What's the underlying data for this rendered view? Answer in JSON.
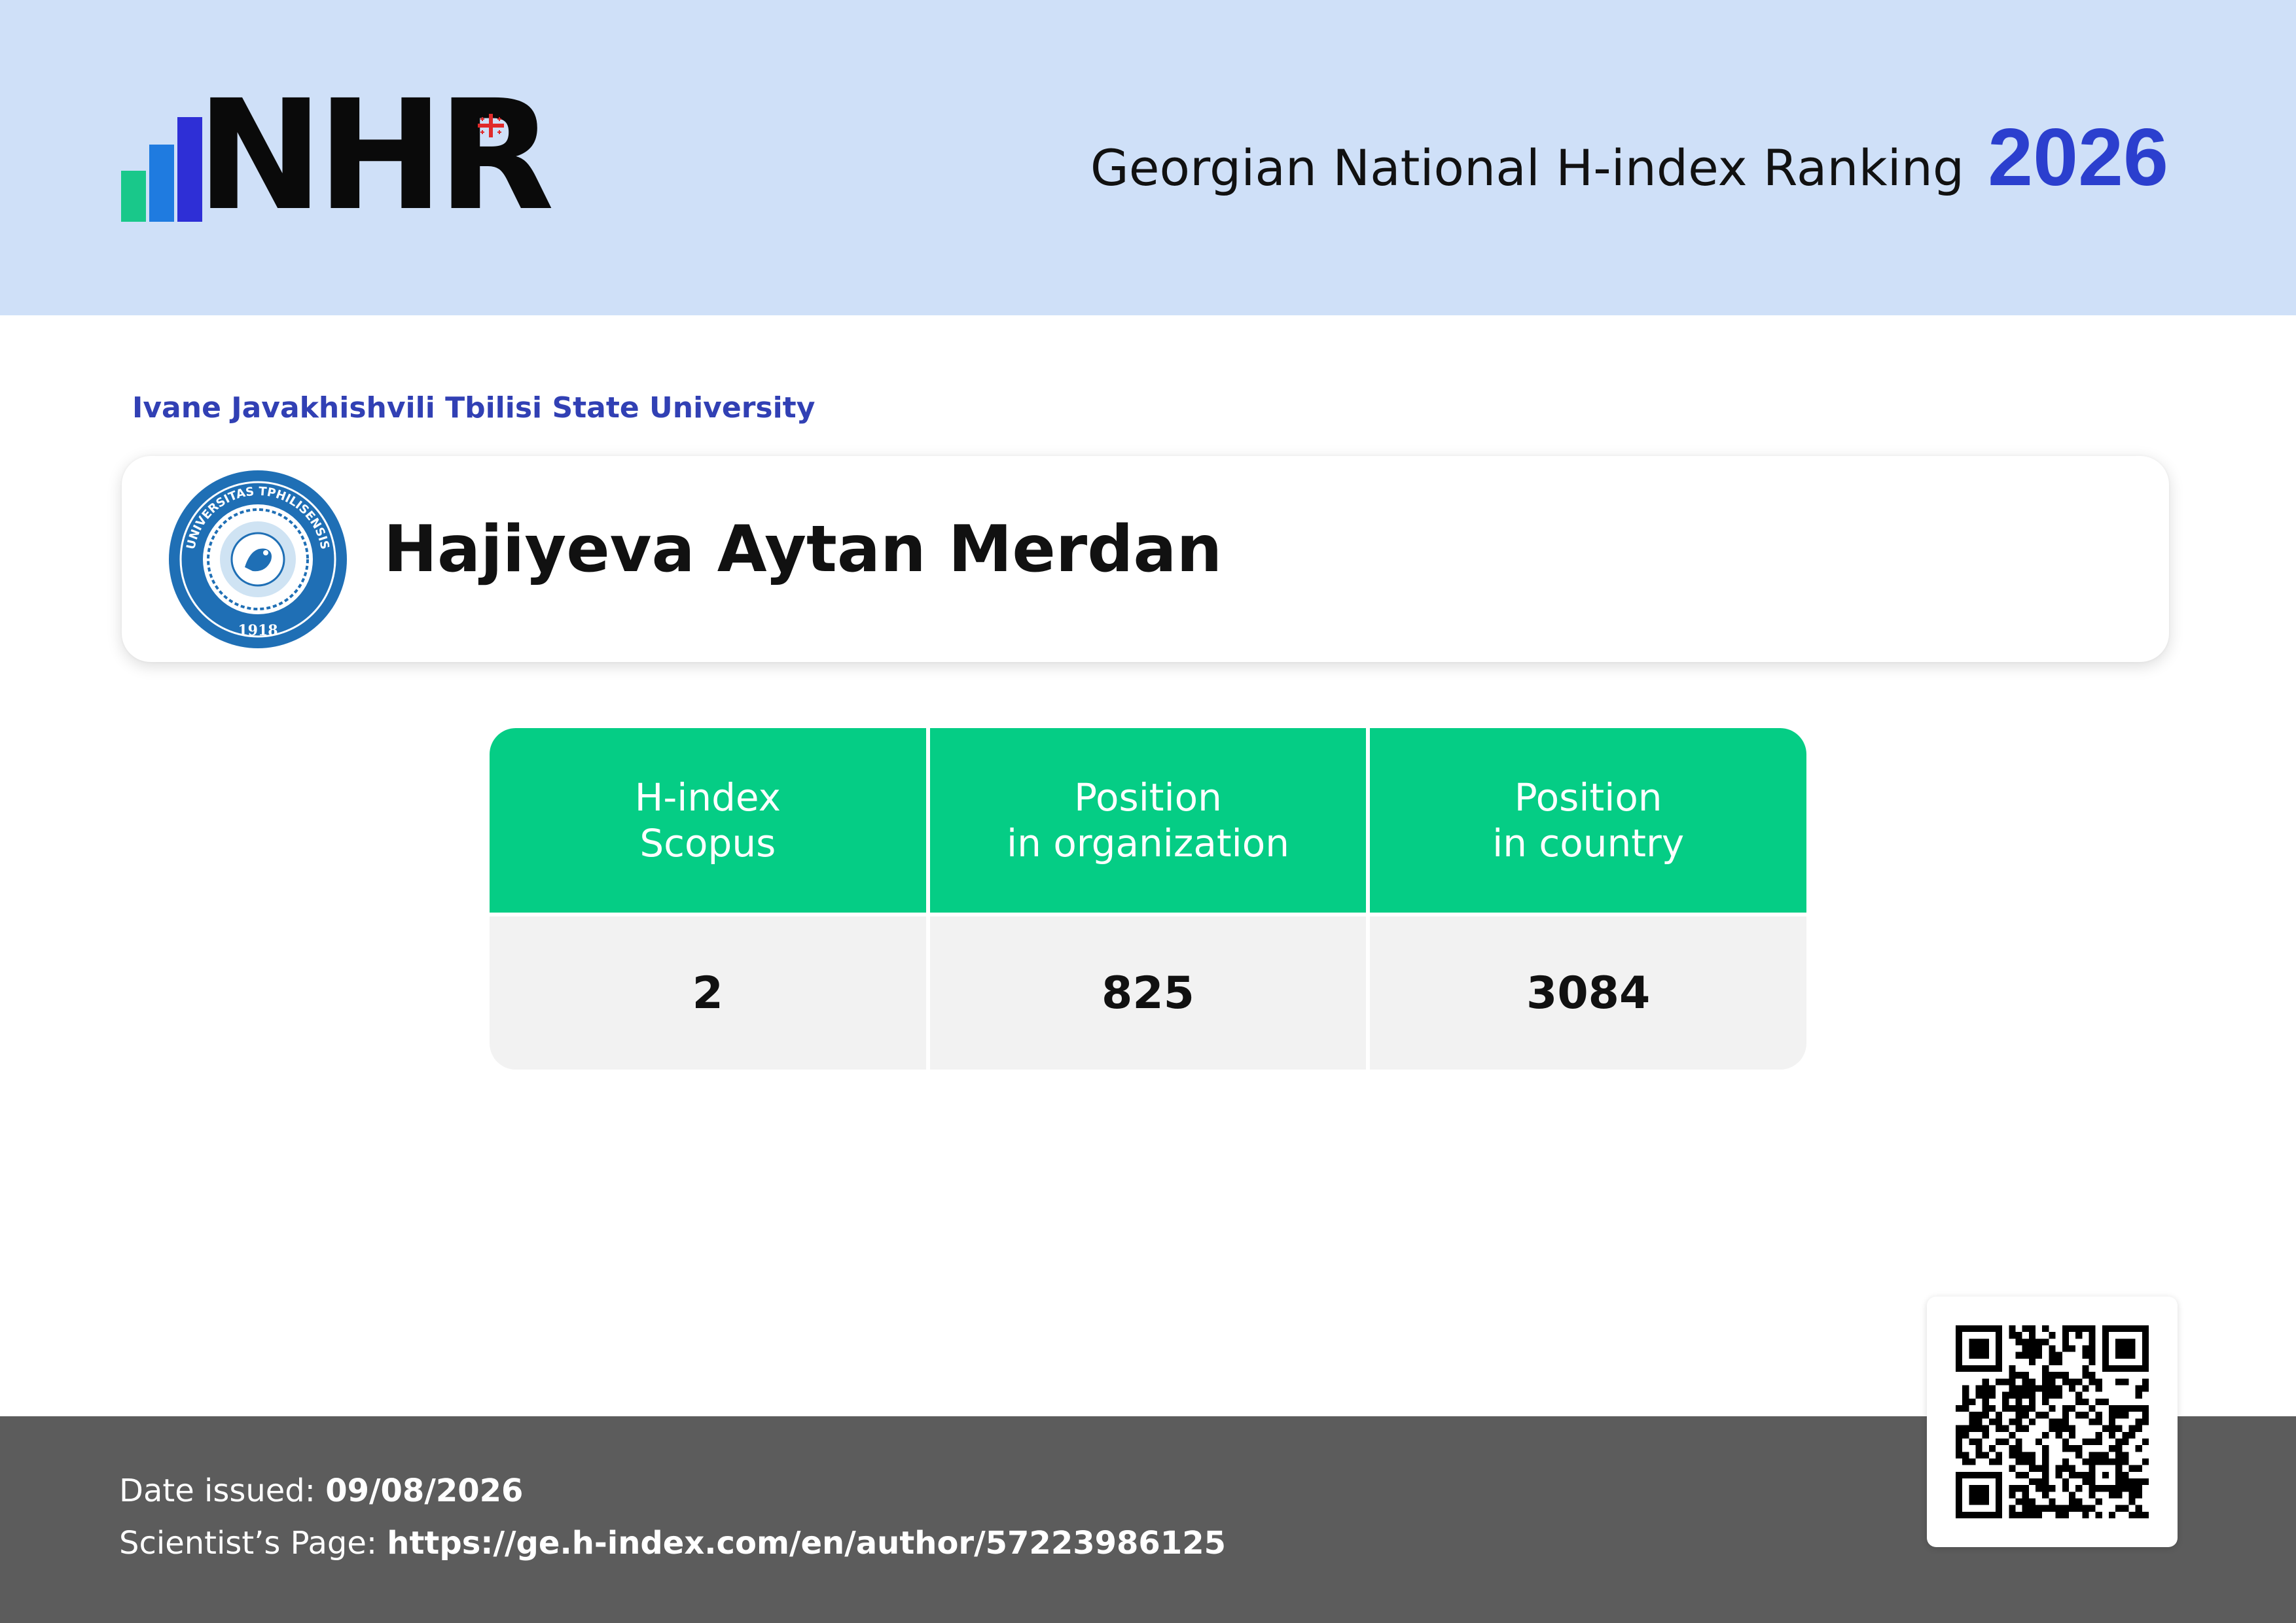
{
  "header": {
    "logo_text": "NHR",
    "title": "Georgian National H-index Ranking",
    "year": "2026"
  },
  "organization": "Ivane Javakhishvili Tbilisi State University",
  "person": {
    "name": "Hajiyeva Aytan Merdan",
    "seal_top": "UNIVERSITAS TPHILISENSIS",
    "seal_year": "1918"
  },
  "stats": {
    "columns": [
      "H-index\nScopus",
      "Position\nin organization",
      "Position\nin country"
    ],
    "values": [
      "2",
      "825",
      "3084"
    ]
  },
  "footer": {
    "date_label": "Date issued:",
    "date_value": "09/08/2026",
    "page_label": "Scientist’s Page:",
    "page_value": "https://ge.h-index.com/en/author/57223986125"
  },
  "colors": {
    "header_bg": "#cfe0f8",
    "accent_blue": "#2b3fce",
    "table_green": "#05cd85",
    "footer_bg": "#5c5c5c"
  },
  "icons": {
    "logo": "nhr-bar-chart-logo",
    "flag": "georgian-flag-icon",
    "seal": "university-seal-icon",
    "qr": "qr-code-icon"
  }
}
